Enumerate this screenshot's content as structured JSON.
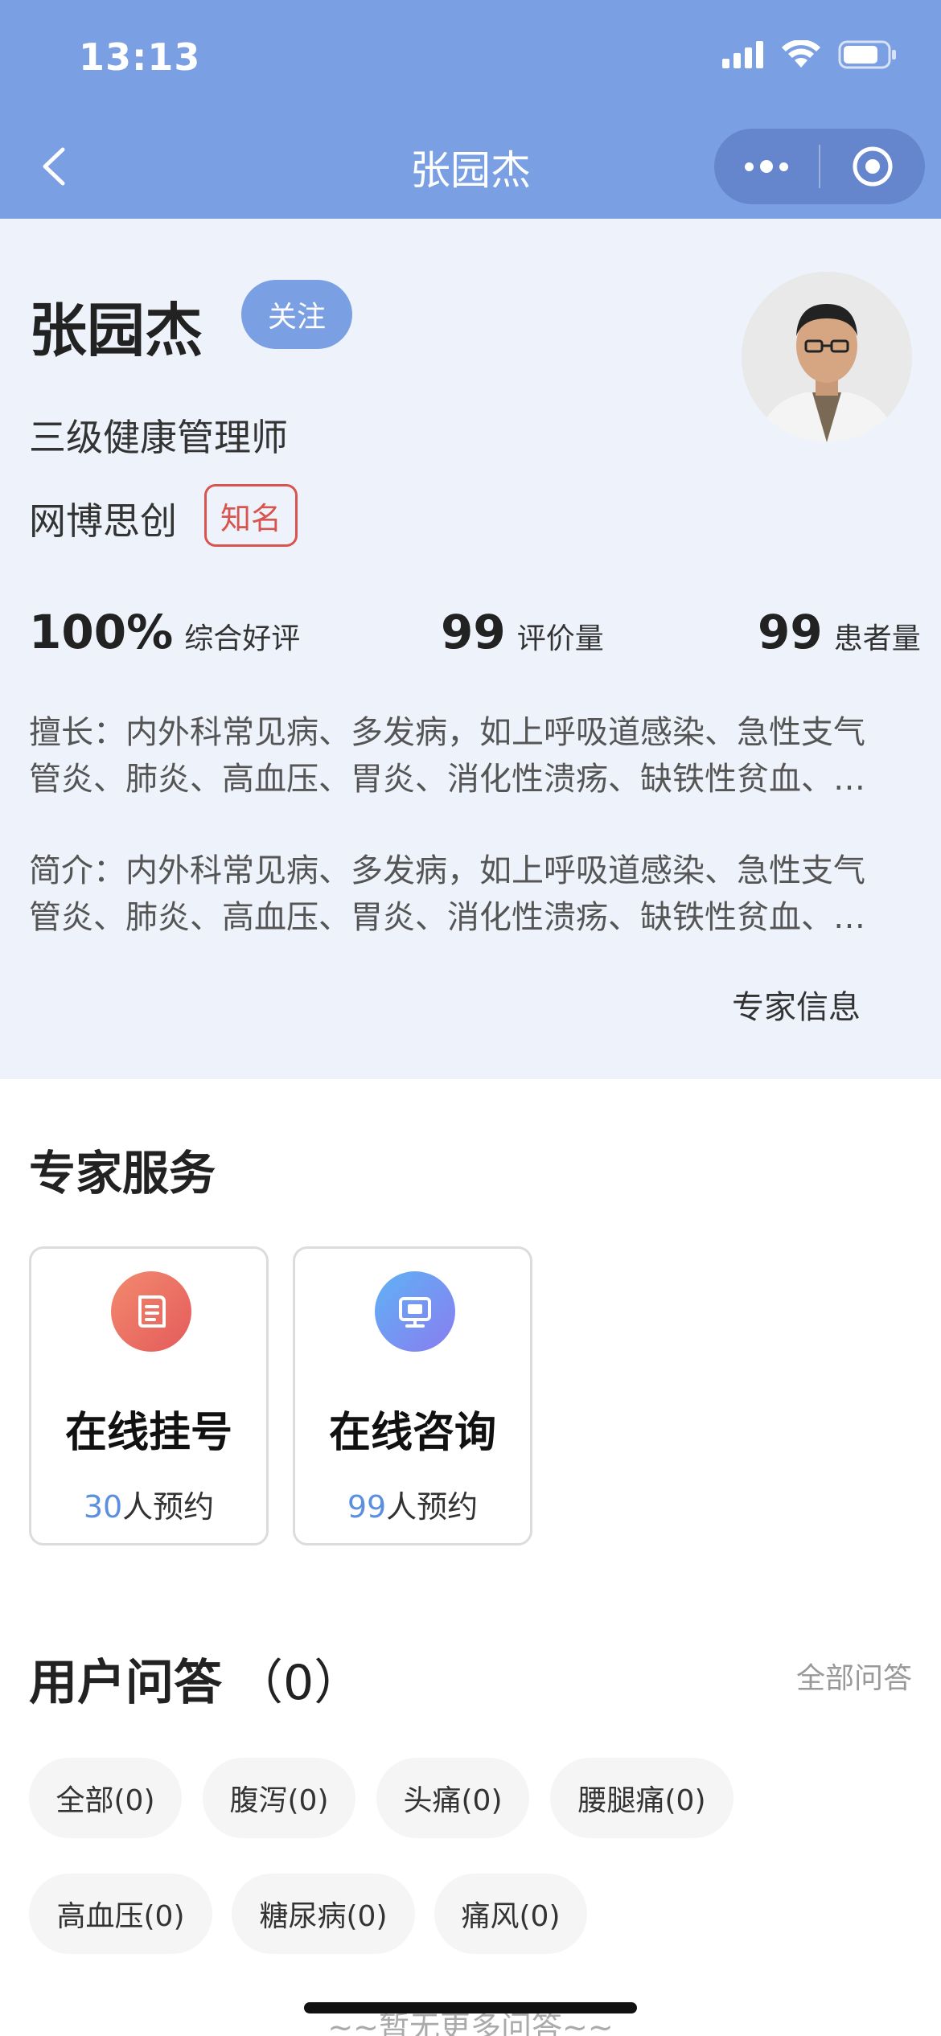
{
  "status_bar": {
    "time": "13:13"
  },
  "nav": {
    "title": "张园杰"
  },
  "profile": {
    "name": "张园杰",
    "follow_label": "关注",
    "title": "三级健康管理师",
    "hospital": "网博思创",
    "tag": "知名",
    "stats": [
      {
        "value": "100%",
        "label": "综合好评"
      },
      {
        "value": "99",
        "label": "评价量"
      },
      {
        "value": "99",
        "label": "患者量"
      }
    ],
    "specialty_line1": "擅长：内外科常见病、多发病，如上呼吸道感染、急性支气",
    "specialty_line2": "管炎、肺炎、高血压、胃炎、消化性溃疡、缺铁性贫血、…",
    "intro_line1": "简介：内外科常见病、多发病，如上呼吸道感染、急性支气",
    "intro_line2": "管炎、肺炎、高血压、胃炎、消化性溃疡、缺铁性贫血、…",
    "expert_info_link": "专家信息"
  },
  "services": {
    "title": "专家服务",
    "items": [
      {
        "name": "在线挂号",
        "count": "30",
        "suffix": "人预约",
        "icon": "registration-icon",
        "color": "#ef6f5d"
      },
      {
        "name": "在线咨询",
        "count": "99",
        "suffix": "人预约",
        "icon": "monitor-icon",
        "color": "#6f8ef0"
      }
    ]
  },
  "qa": {
    "title": "用户问答",
    "count": "（0）",
    "all_link": "全部问答",
    "chips": [
      "全部(0)",
      "腹泻(0)",
      "头痛(0)",
      "腰腿痛(0)",
      "高血压(0)",
      "糖尿病(0)",
      "痛风(0)"
    ],
    "no_more": "~~暂无更多问答~~"
  }
}
